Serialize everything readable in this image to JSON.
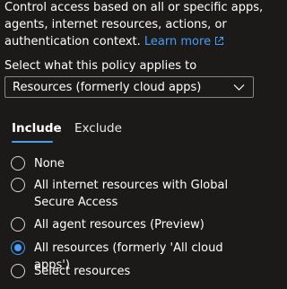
{
  "description": {
    "text": "Control access based on all or specific apps, agents, internet resources, actions, or authentication context.",
    "learn_more_label": "Learn more"
  },
  "applies_to": {
    "label": "Select what this policy applies to",
    "selected_value": "Resources (formerly cloud apps)",
    "chevron_icon": "chevron-down-icon"
  },
  "tabs": [
    {
      "label": "Include",
      "selected": true
    },
    {
      "label": "Exclude",
      "selected": false
    }
  ],
  "options": [
    {
      "label": "None",
      "checked": false
    },
    {
      "label": "All internet resources with Global Secure Access",
      "checked": false
    },
    {
      "label": "All agent resources (Preview)",
      "checked": false
    },
    {
      "label": "All resources (formerly 'All cloud apps')",
      "checked": true
    },
    {
      "label": "Select resources",
      "checked": false
    }
  ],
  "colors": {
    "background": "#1b1a19",
    "text": "#ffffff",
    "accent": "#479ef5",
    "border": "#8a8886"
  }
}
